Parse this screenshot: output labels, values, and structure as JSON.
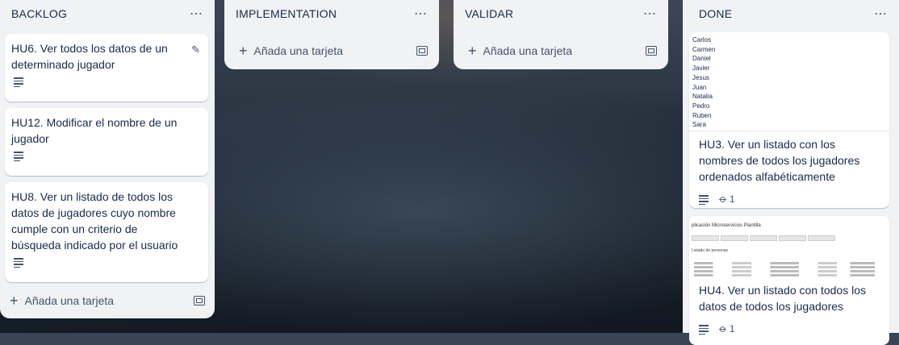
{
  "board": {
    "lists": [
      {
        "title": "BACKLOG",
        "cards": [
          {
            "title": "HU6. Ver todos los datos de un determinado jugador"
          },
          {
            "title": "HU12. Modificar el nombre de un jugador"
          },
          {
            "title": "HU8. Ver un listado de todos los datos de jugadores cuyo nombre cumple con un criterio de búsqueda indicado por el usuario"
          }
        ],
        "add_label": "Añada una tarjeta"
      },
      {
        "title": "IMPLEMENTATION",
        "add_label": "Añada una tarjeta"
      },
      {
        "title": "VALIDAR",
        "add_label": "Añada una tarjeta"
      },
      {
        "title": "DONE",
        "cards": [
          {
            "cover_names": [
              "Carlos",
              "Carmen",
              "Daniel",
              "Javier",
              "Jesus",
              "Juan",
              "Natalia",
              "Pedro",
              "Ruben",
              "Sara"
            ],
            "title": "HU3. Ver un listado con los nombres de todos los jugadores ordenados alfabéticamente",
            "attachments": "1"
          },
          {
            "cover_title": "plicación Microservicios Plantilla",
            "cover_subtitle": "Listado de personas",
            "title": "HU4. Ver un listado con todos los datos de todos los jugadores",
            "attachments": "1"
          }
        ]
      }
    ]
  },
  "icons": {
    "more": "⋯",
    "plus": "+",
    "edit": "✎",
    "attachment": "⌀"
  }
}
